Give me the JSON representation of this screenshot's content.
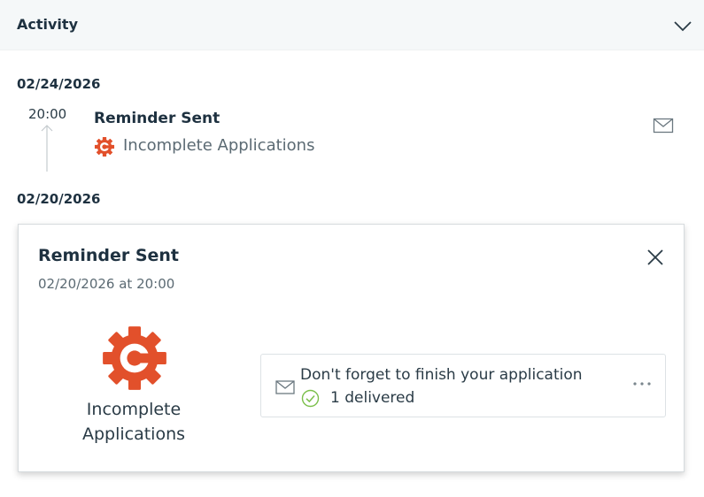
{
  "header": {
    "title": "Activity",
    "toggle_icon": "chevron-down-icon"
  },
  "groups": [
    {
      "date": "02/24/2026",
      "events": [
        {
          "time": "20:00",
          "title": "Reminder Sent",
          "subtitle": "Incomplete Applications",
          "subtitle_icon": "gear-c-logo-icon",
          "action_icon": "mail-icon"
        }
      ]
    },
    {
      "date": "02/20/2026"
    }
  ],
  "detail_card": {
    "title": "Reminder Sent",
    "subtitle": "02/20/2026 at 20:00",
    "logo_icon": "gear-c-logo-icon",
    "logo_label": "Incomplete Applications",
    "message": {
      "title": "Don't forget to finish your application",
      "status": "1 delivered",
      "status_icon": "check-circle-icon"
    }
  },
  "colors": {
    "brand": "#e2502b",
    "success": "#7bbf4b",
    "header_bg": "#f5f8f9",
    "text_dark": "#1e3140",
    "text_muted": "#5b6a73"
  }
}
